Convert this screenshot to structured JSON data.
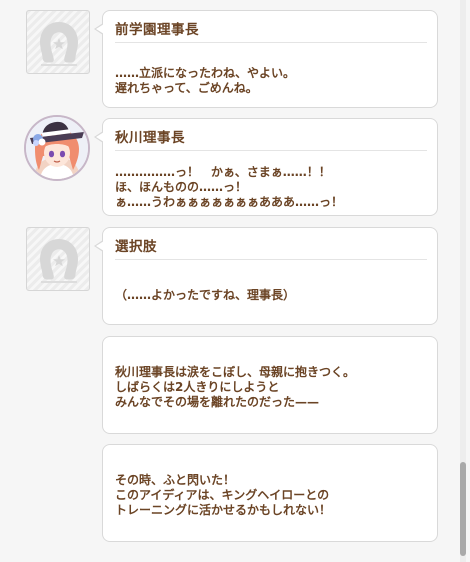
{
  "entries": [
    {
      "speaker": "前学園理事長",
      "avatar": "silhouette-placeholder",
      "lines": [
        "……立派になったわね、やよい。",
        "遅れちゃって、ごめんね。"
      ]
    },
    {
      "speaker": "秋川理事長",
      "avatar": "akikawa-portrait",
      "lines": [
        "……………っ！　かぁ、さまぁ……！！",
        "ほ、ほんものの……っ！",
        "ぁ……うわぁぁぁぁぁぁぁあああ……っ！"
      ]
    },
    {
      "speaker": "選択肢",
      "avatar": "silhouette-placeholder",
      "lines": [
        "（……よかったですね、理事長）"
      ]
    },
    {
      "speaker": "",
      "lines": [
        "秋川理事長は涙をこぼし、母親に抱きつく。",
        "しばらくは2人きりにしようと",
        "みんなでその場を離れたのだった——"
      ]
    },
    {
      "speaker": "",
      "lines": [
        "その時、ふと閃いた！",
        "このアイディアは、キングヘイローとの",
        "トレーニングに活かせるかもしれない！"
      ]
    }
  ],
  "colors": {
    "text_brown": "#6b4425",
    "card_border": "#d9d9d9",
    "background": "#f6f6f6"
  }
}
